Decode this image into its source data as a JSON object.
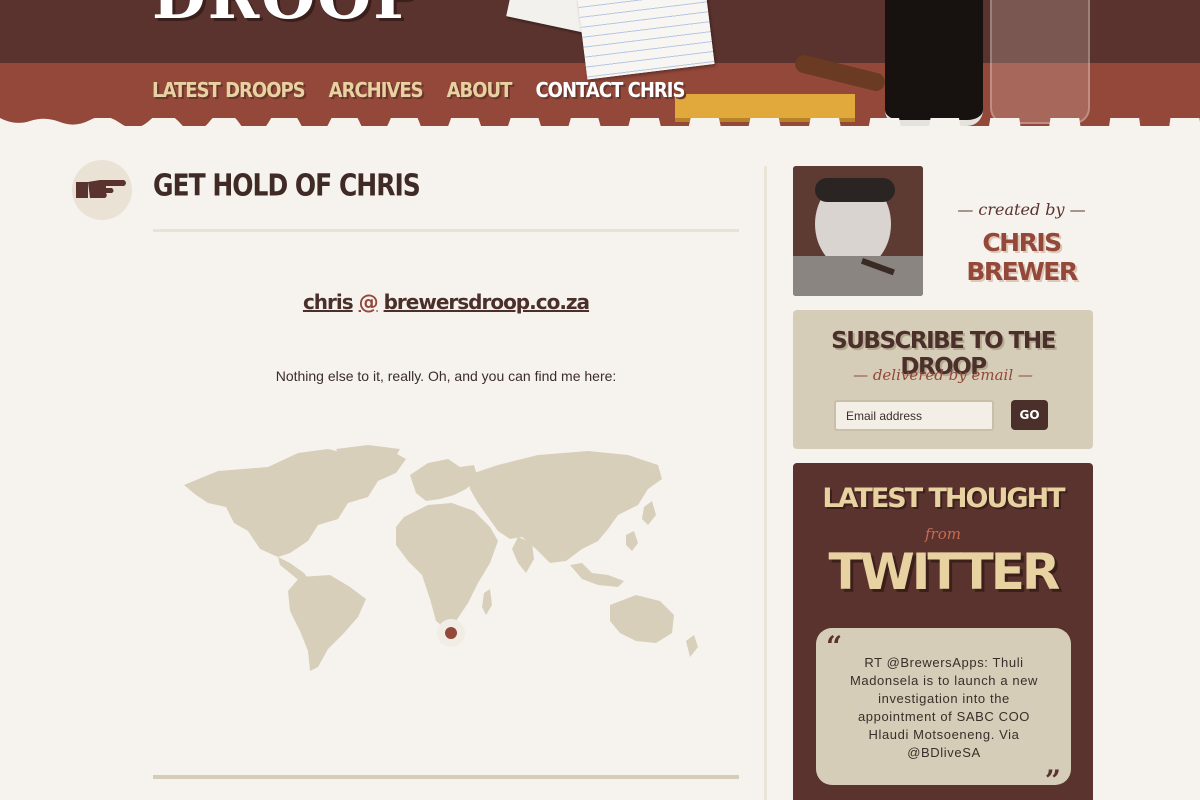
{
  "header": {
    "logo": "DROOP",
    "nav": [
      {
        "label": "LATEST DROOPS"
      },
      {
        "label": "ARCHIVES"
      },
      {
        "label": "ABOUT"
      },
      {
        "label": "CONTACT CHRIS"
      }
    ],
    "active_nav": "CONTACT CHRIS"
  },
  "main": {
    "title": "GET HOLD OF CHRIS",
    "email_user": "chris",
    "email_at": "@",
    "email_domain": "brewersdroop.co.za",
    "body": "Nothing else to it, really. Oh, and you can find me here:",
    "map_marker": "pin-icon"
  },
  "sidebar": {
    "created_by": "— created by —",
    "author_name": "CHRIS BREWER",
    "subscribe": {
      "title": "SUBSCRIBE TO THE DROOP",
      "subtitle": "— delivered by email —",
      "input_placeholder": "Email address",
      "button": "GO"
    },
    "twitter": {
      "heading_top": "LATEST THOUGHT",
      "heading_from": "from",
      "heading_main": "TWITTER",
      "tweet": "RT @BrewersApps: Thuli Madonsela is to launch a new investigation into the appointment of SABC COO Hlaudi Motsoeneng. Via @BDliveSA"
    }
  },
  "colors": {
    "dark_brown": "#5a332e",
    "rust": "#93483a",
    "tan": "#d6cdb8",
    "cream": "#f6f3ee",
    "nav_gold": "#e8d2a2"
  }
}
